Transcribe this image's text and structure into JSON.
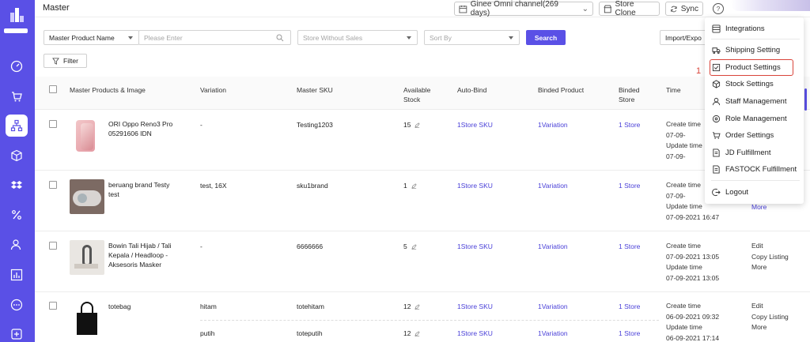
{
  "header": {
    "title": "Master",
    "channel_select": "Ginee Omni channel(269 days)",
    "store_clone": "Store Clone",
    "sync": "Sync"
  },
  "filters": {
    "field_select": "Master Product Name",
    "search_placeholder": "Please Enter",
    "store_select": "Store Without Sales",
    "sort_select": "Sort By",
    "search_button": "Search",
    "import_export": "Import/Expo",
    "filter_button": "Filter"
  },
  "table": {
    "headers": {
      "product": "Master Products & Image",
      "variation": "Variation",
      "sku": "Master SKU",
      "stock_1": "Available",
      "stock_2": "Stock",
      "autobind": "Auto-Bind",
      "binded_product": "Binded Product",
      "binded_store_1": "Binded",
      "binded_store_2": "Store",
      "time": "Time"
    },
    "rows": [
      {
        "name": "ORI Oppo Reno3 Pro 05291606 IDN",
        "variation": "-",
        "sku": "Testing1203",
        "stock": "15",
        "autobind": "1Store SKU",
        "binded": "1Variation",
        "store": "1 Store",
        "create_label": "Create time",
        "create_time": "07-09-",
        "update_label": "Update time",
        "update_time": "07-09-"
      },
      {
        "name": "beruang brand Testy test",
        "variation": "test, 16X",
        "sku": "sku1brand",
        "stock": "1",
        "autobind": "1Store SKU",
        "binded": "1Variation",
        "store": "1 Store",
        "create_label": "Create time",
        "create_time": "07-09-",
        "update_label": "Update time",
        "update_time": "07-09-2021 16:47",
        "more": "More"
      },
      {
        "name": "Bowin Tali Hijab / Tali Kepala / Headloop - Aksesoris Masker",
        "variation": "-",
        "sku": "6666666",
        "stock": "5",
        "autobind": "1Store SKU",
        "binded": "1Variation",
        "store": "1 Store",
        "create_label": "Create time",
        "create_time": "07-09-2021 13:05",
        "update_label": "Update time",
        "update_time": "07-09-2021 13:05",
        "edit": "Edit",
        "copy": "Copy Listing",
        "more": "More"
      },
      {
        "name": "totebag",
        "variation": "hitam",
        "sku": "totehitam",
        "stock": "12",
        "autobind": "1Store SKU",
        "binded": "1Variation",
        "store": "1 Store",
        "create_label": "Create time",
        "create_time": "06-09-2021 09:32",
        "update_label": "Update time",
        "update_time": "06-09-2021 17:14",
        "edit": "Edit",
        "copy": "Copy Listing",
        "more": "More",
        "sub": {
          "variation": "putih",
          "sku": "toteputih",
          "stock": "12",
          "autobind": "1Store SKU",
          "binded": "1Variation",
          "store": "1 Store"
        }
      }
    ]
  },
  "menu": {
    "items": [
      "Integrations",
      "Shipping Setting",
      "Product Settings",
      "Stock Settings",
      "Staff Management",
      "Role Management",
      "Order Settings",
      "JD Fulfillment",
      "FASTOCK Fulfillment",
      "Logout"
    ],
    "annotation": "1"
  },
  "colors": {
    "brand": "#5a50e6",
    "link": "#4a40d8",
    "highlight": "#d9443a"
  }
}
